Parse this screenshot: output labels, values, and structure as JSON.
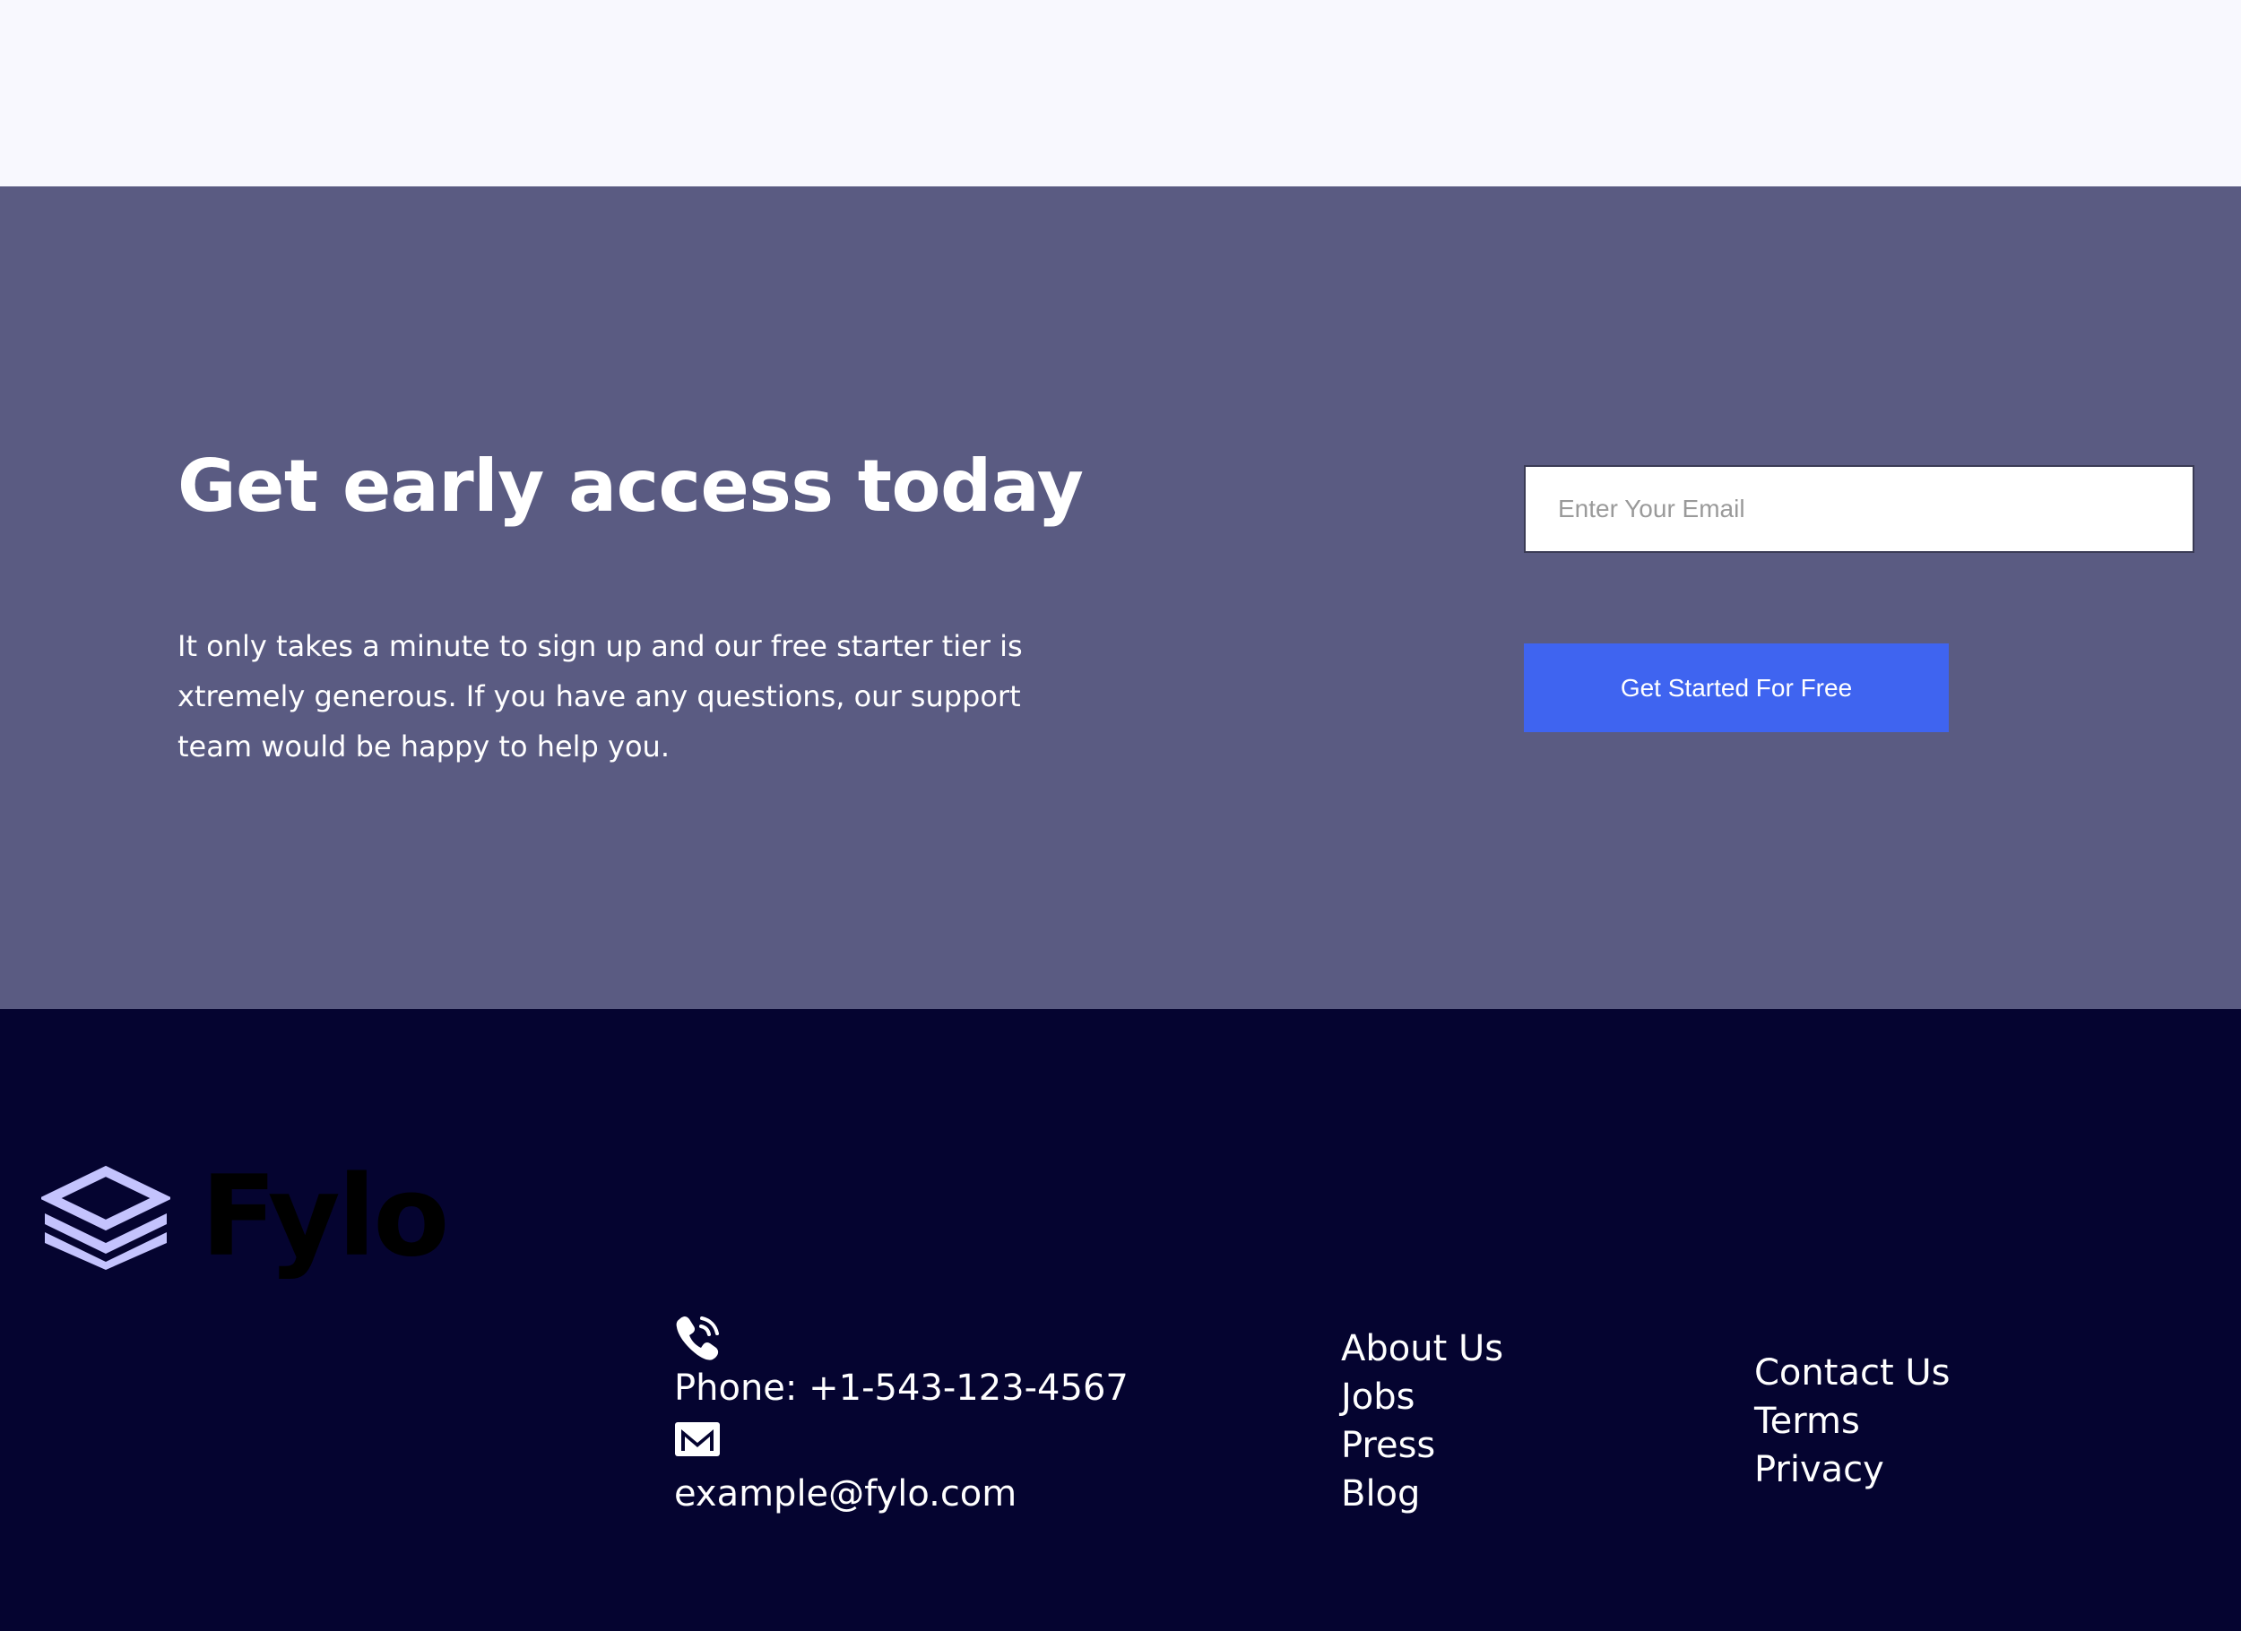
{
  "cta": {
    "title": "Get early access today",
    "description": "It only takes a minute to sign up and our free starter tier is xtremely generous. If you have any questions, our support team would be happy to help you.",
    "email_placeholder": "Enter Your Email",
    "button_label": "Get Started For Free"
  },
  "footer": {
    "logo_text": "Fylo",
    "phone": "Phone: +1-543-123-4567",
    "email": "example@fylo.com",
    "links_primary": [
      "About Us",
      "Jobs",
      "Press",
      "Blog"
    ],
    "links_secondary": [
      "Contact Us",
      "Terms",
      "Privacy"
    ]
  },
  "icons": {
    "phone": "phone-icon",
    "email": "mail-icon",
    "logo": "stacked-layers-logo"
  },
  "colors": {
    "top_band": "#f8f8fe",
    "cta_background": "#5a5b82",
    "button": "#3f64f0",
    "footer_background": "#050430",
    "logo_mark": "#c4c3fd"
  }
}
